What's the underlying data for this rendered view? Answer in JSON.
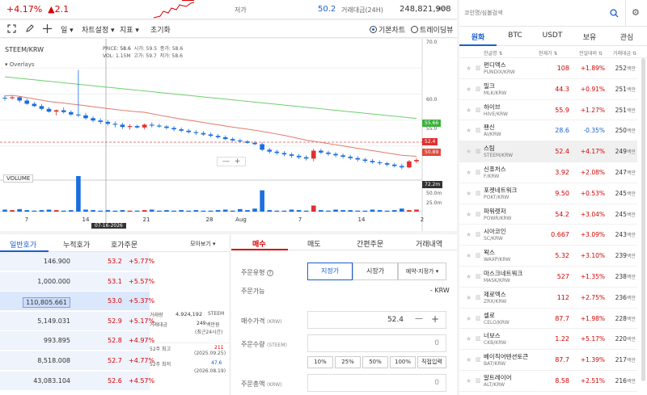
{
  "header": {
    "change_pct": "+4.17%",
    "change_amt": "▲2.1",
    "low_label": "저가",
    "low_value": "50.2",
    "volume_label": "거래대금(24H)",
    "volume_value": "248,821,908",
    "volume_unit": "KRW"
  },
  "toolbar": {
    "period": "일",
    "chart_settings": "차트설정",
    "indicator": "지표",
    "reset": "초기화",
    "basic_chart": "기본차트",
    "tradingview": "트레이딩뷰"
  },
  "chart": {
    "symbol": "STEEM/KRW",
    "overlays": "Overlays",
    "ohlc": {
      "price_l": "PRICE:",
      "price": "58.6",
      "vol_l": "VOL:",
      "vol": "1.15M",
      "open_l": "시가:",
      "open": "59.5",
      "high_l": "고가:",
      "high": "59.7",
      "close_l": "종가:",
      "close": "58.6",
      "low_l": "저가:",
      "low": "58.6"
    },
    "volume_label": "VOLUME",
    "crosshair_date": "07-16-2026",
    "badge_ma": "55.66",
    "badge_price": "52.4",
    "badge_ma2": "50.89",
    "badge_vol": "72.2m",
    "y_ticks": [
      "70.0",
      "60.0",
      "55.0",
      "45.0"
    ],
    "vol_ticks": [
      "50.0m",
      "25.0m"
    ],
    "x_ticks": [
      "7",
      "14",
      "21",
      "28",
      "Aug",
      "7",
      "14",
      "2"
    ],
    "ctrl_minus": "—",
    "ctrl_plus": "+"
  },
  "chart_data": {
    "type": "candlestick",
    "ylim": [
      43,
      71
    ],
    "candles": [
      [
        59,
        59.5,
        58.4,
        58.9
      ],
      [
        58.9,
        59.4,
        58.6,
        59.1
      ],
      [
        59.1,
        59.3,
        58,
        58.4
      ],
      [
        58.4,
        58.8,
        57.5,
        57.7
      ],
      [
        57.7,
        58.1,
        57,
        57.2
      ],
      [
        57.2,
        57.6,
        56.3,
        56.6
      ],
      [
        56.6,
        57,
        55.8,
        56
      ],
      [
        56,
        56.5,
        55.2,
        56.3
      ],
      [
        56.3,
        56.9,
        55.6,
        55.9
      ],
      [
        55.9,
        56.3,
        55.1,
        55.4
      ],
      [
        55.4,
        65,
        54.8,
        55.2
      ],
      [
        55.2,
        55.7,
        54.3,
        54.6
      ],
      [
        54.6,
        55,
        53.7,
        54.1
      ],
      [
        54.1,
        54.6,
        53.3,
        53.8
      ],
      [
        53.8,
        54.2,
        53,
        53.4
      ],
      [
        53.4,
        53.9,
        52.6,
        53.2
      ],
      [
        53.2,
        53.6,
        52.3,
        52.7
      ],
      [
        52.7,
        53.3,
        52.1,
        52.9
      ],
      [
        52.9,
        53.2,
        52.4,
        52.6
      ],
      [
        52.6,
        53.5,
        52.2,
        53.2
      ],
      [
        53.2,
        53.7,
        52.6,
        53
      ],
      [
        53,
        53.4,
        52.5,
        52.8
      ],
      [
        52.8,
        53.1,
        52.2,
        52.5
      ],
      [
        52.5,
        52.9,
        51.8,
        52.2
      ],
      [
        52.2,
        52.6,
        51.6,
        51.9
      ],
      [
        51.9,
        52.3,
        51.3,
        51.6
      ],
      [
        51.6,
        52,
        51,
        51.4
      ],
      [
        51.4,
        51.8,
        50.8,
        51.1
      ],
      [
        51.1,
        51.5,
        50.5,
        50.8
      ],
      [
        50.8,
        51.2,
        50.2,
        50.5
      ],
      [
        50.5,
        50.9,
        49.9,
        50.1
      ],
      [
        50.1,
        50.5,
        49.6,
        49.8
      ],
      [
        49.8,
        50.2,
        49.3,
        49.6
      ],
      [
        49.6,
        49.9,
        49.1,
        49.3
      ],
      [
        49.3,
        49.7,
        48.8,
        49
      ],
      [
        49,
        49.4,
        47.5,
        47.8
      ],
      [
        47.8,
        48.2,
        47,
        47.4
      ],
      [
        47.4,
        47.8,
        46.7,
        47.1
      ],
      [
        47.1,
        47.5,
        46.4,
        46.8
      ],
      [
        46.8,
        47.2,
        46.1,
        46.5
      ],
      [
        46.5,
        46.9,
        45.8,
        46.2
      ],
      [
        46.2,
        46.6,
        45.5,
        45.9
      ],
      [
        45.9,
        48,
        45.3,
        47.6
      ],
      [
        47.6,
        48,
        46.9,
        47.2
      ],
      [
        47.2,
        47.6,
        46.5,
        46.9
      ],
      [
        46.9,
        47.3,
        46.2,
        46.6
      ],
      [
        46.6,
        47,
        45.9,
        46.3
      ],
      [
        46.3,
        46.7,
        45.6,
        46
      ],
      [
        46,
        46.4,
        45.3,
        45.7
      ],
      [
        45.7,
        46.1,
        45,
        45.4
      ],
      [
        45.4,
        45.8,
        44.8,
        45.1
      ],
      [
        45.1,
        45.5,
        44.5,
        44.9
      ],
      [
        44.9,
        45.2,
        44.2,
        44.6
      ],
      [
        44.6,
        45,
        44,
        44.3
      ],
      [
        44.3,
        44.8,
        43.6,
        44
      ],
      [
        44,
        45.6,
        43.8,
        45.3
      ],
      [
        45.3,
        46,
        44.9,
        45.6
      ]
    ],
    "volumes": [
      4,
      3,
      5,
      3,
      2,
      3,
      4,
      3,
      2,
      3,
      70,
      4,
      3,
      2,
      3,
      2,
      3,
      2,
      2,
      3,
      4,
      2,
      3,
      2,
      3,
      2,
      3,
      2,
      2,
      3,
      4,
      2,
      5,
      3,
      6,
      42,
      3,
      2,
      2,
      4,
      3,
      2,
      12,
      3,
      2,
      4,
      3,
      3,
      2,
      2,
      4,
      3,
      2,
      3,
      6,
      3,
      4
    ]
  },
  "orderbook": {
    "tabs": [
      "일반호가",
      "누적호가",
      "호가주문"
    ],
    "more": "모아보기",
    "rows": [
      {
        "vol": "146.900",
        "price": "53.2",
        "pct": "+5.77%"
      },
      {
        "vol": "1,000.000",
        "price": "53.1",
        "pct": "+5.57%"
      },
      {
        "vol": "110,805.661",
        "price": "53.0",
        "pct": "+5.37%"
      },
      {
        "vol": "5,149.031",
        "price": "52.9",
        "pct": "+5.17%"
      },
      {
        "vol": "993.895",
        "price": "52.8",
        "pct": "+4.97%"
      },
      {
        "vol": "8,518.008",
        "price": "52.7",
        "pct": "+4.77%"
      },
      {
        "vol": "43,083.104",
        "price": "52.6",
        "pct": "+4.57%"
      }
    ],
    "info": {
      "vol_label": "거래량",
      "vol": "4,924,192",
      "vol_unit": "STEEM",
      "amt_label": "거래대금",
      "amt": "249",
      "amt_unit": "백만원",
      "amt_note": "(최근24시간)",
      "high52_label": "52주 최고",
      "high52": "211",
      "high52_date": "(2025.09.25)",
      "low52_label": "52주 최저",
      "low52": "47.6",
      "low52_date": "(2026.08.19)"
    }
  },
  "trade": {
    "tabs": [
      "매수",
      "매도",
      "간편주문",
      "거래내역"
    ],
    "order_type_label": "주문유형",
    "order_types": [
      "지정가",
      "시장가",
      "예약-지정가"
    ],
    "available_label": "주문가능",
    "available_value": "- KRW",
    "price_label": "매수가격",
    "price_unit": "(KRW)",
    "price_value": "52.4",
    "qty_label": "주문수량",
    "qty_unit": "(STEEM)",
    "qty_value": "0",
    "pct_buttons": [
      "10%",
      "25%",
      "50%",
      "100%",
      "직접입력"
    ],
    "total_label": "주문총액",
    "total_unit": "(KRW)",
    "total_value": "0"
  },
  "market": {
    "search_placeholder": "코인명/심볼검색",
    "tabs": [
      "원화",
      "BTC",
      "USDT",
      "보유",
      "관심"
    ],
    "head": {
      "name": "한글명",
      "price": "현재가",
      "change": "전일대비",
      "volume": "거래대금"
    },
    "coins": [
      {
        "name": "펀디엑스",
        "sym": "PUNDIX/KRW",
        "price": "108",
        "chg": "+1.89%",
        "tv": "252",
        "dir": "up"
      },
      {
        "name": "밀크",
        "sym": "MLK/KRW",
        "price": "44.3",
        "chg": "+0.91%",
        "tv": "251",
        "dir": "up"
      },
      {
        "name": "하이브",
        "sym": "HIVE/KRW",
        "price": "55.9",
        "chg": "+1.27%",
        "tv": "251",
        "dir": "up"
      },
      {
        "name": "팬신",
        "sym": "AI/KRW",
        "price": "28.6",
        "chg": "-0.35%",
        "tv": "250",
        "dir": "dn"
      },
      {
        "name": "스팀",
        "sym": "STEEM/KRW",
        "price": "52.4",
        "chg": "+4.17%",
        "tv": "249",
        "dir": "up"
      },
      {
        "name": "신퓨처스",
        "sym": "F/KRW",
        "price": "3.92",
        "chg": "+2.08%",
        "tv": "247",
        "dir": "up"
      },
      {
        "name": "포켓네트워크",
        "sym": "POKT/KRW",
        "price": "9.50",
        "chg": "+0.53%",
        "tv": "245",
        "dir": "up"
      },
      {
        "name": "파워렛저",
        "sym": "POWR/KRW",
        "price": "54.2",
        "chg": "+3.04%",
        "tv": "245",
        "dir": "up"
      },
      {
        "name": "시아코인",
        "sym": "SC/KRW",
        "price": "0.667",
        "chg": "+3.09%",
        "tv": "243",
        "dir": "up"
      },
      {
        "name": "왁스",
        "sym": "WAXP/KRW",
        "price": "5.32",
        "chg": "+3.10%",
        "tv": "239",
        "dir": "up"
      },
      {
        "name": "마스크네트워크",
        "sym": "MASK/KRW",
        "price": "527",
        "chg": "+1.35%",
        "tv": "238",
        "dir": "up"
      },
      {
        "name": "제로엑스",
        "sym": "ZRX/KRW",
        "price": "112",
        "chg": "+2.75%",
        "tv": "236",
        "dir": "up"
      },
      {
        "name": "셀로",
        "sym": "CELO/KRW",
        "price": "87.7",
        "chg": "+1.98%",
        "tv": "228",
        "dir": "up"
      },
      {
        "name": "너보스",
        "sym": "CKB/KRW",
        "price": "1.22",
        "chg": "+5.17%",
        "tv": "220",
        "dir": "up"
      },
      {
        "name": "베이직어텐션토큰",
        "sym": "BAT/KRW",
        "price": "87.7",
        "chg": "+1.39%",
        "tv": "217",
        "dir": "up"
      },
      {
        "name": "알트레이어",
        "sym": "ALT/KRW",
        "price": "8.58",
        "chg": "+2.51%",
        "tv": "216",
        "dir": "up"
      }
    ],
    "tv_unit": "백만"
  }
}
